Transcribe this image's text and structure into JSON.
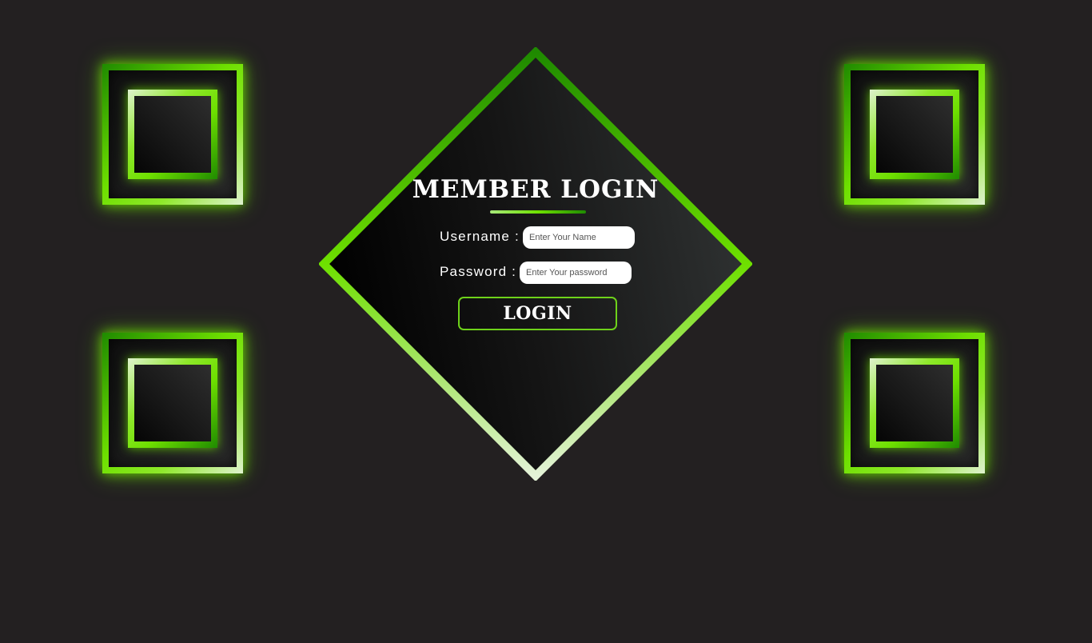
{
  "login": {
    "title": "MEMBER LOGIN",
    "username_label": "Username :",
    "username_placeholder": "Enter Your Name",
    "username_value": "",
    "password_label": "Password :",
    "password_placeholder": "Enter Your password",
    "password_value": "",
    "button_label": "LOGIN"
  },
  "theme": {
    "background": "#232021",
    "accent_dark_green": "#1f8a00",
    "accent_green": "#6ee000",
    "accent_pale": "#dff2cf"
  }
}
